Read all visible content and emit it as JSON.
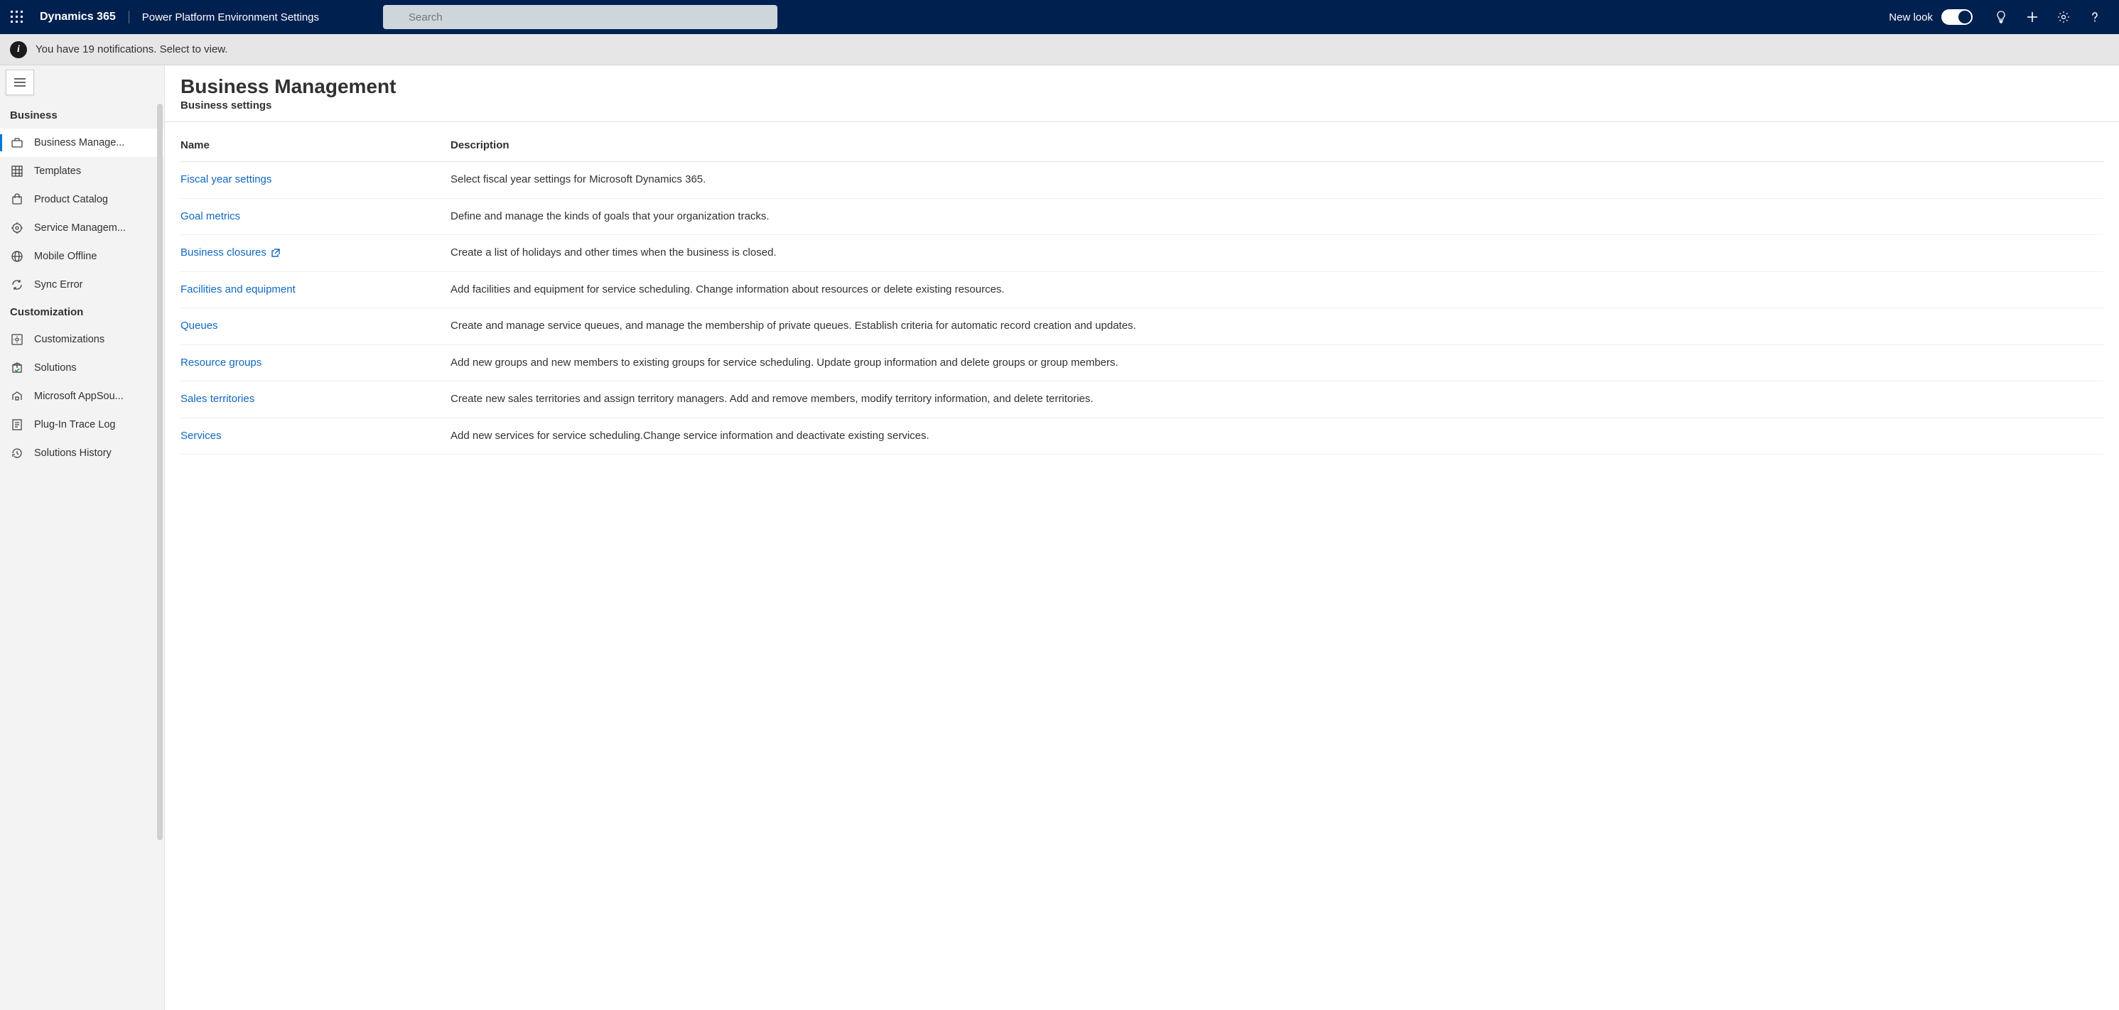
{
  "header": {
    "product": "Dynamics 365",
    "breadcrumb": "Power Platform Environment Settings",
    "search_placeholder": "Search",
    "new_look_label": "New look"
  },
  "notification": {
    "text": "You have 19 notifications. Select to view."
  },
  "sidebar": {
    "sections": [
      {
        "title": "Business",
        "items": [
          {
            "label": "Business Manage...",
            "active": true,
            "icon": "briefcase"
          },
          {
            "label": "Templates",
            "icon": "grid"
          },
          {
            "label": "Product Catalog",
            "icon": "cart"
          },
          {
            "label": "Service Managem...",
            "icon": "service"
          },
          {
            "label": "Mobile Offline",
            "icon": "globe"
          },
          {
            "label": "Sync Error",
            "icon": "sync-error"
          }
        ]
      },
      {
        "title": "Customization",
        "items": [
          {
            "label": "Customizations",
            "icon": "gear-box"
          },
          {
            "label": "Solutions",
            "icon": "package"
          },
          {
            "label": "Microsoft AppSou...",
            "icon": "store"
          },
          {
            "label": "Plug-In Trace Log",
            "icon": "log"
          },
          {
            "label": "Solutions History",
            "icon": "history"
          }
        ]
      }
    ]
  },
  "page": {
    "title": "Business Management",
    "subtitle": "Business settings",
    "columns": {
      "name": "Name",
      "description": "Description"
    },
    "rows": [
      {
        "name": "Fiscal year settings",
        "external": false,
        "description": "Select fiscal year settings for Microsoft Dynamics 365."
      },
      {
        "name": "Goal metrics",
        "external": false,
        "description": "Define and manage the kinds of goals that your organization tracks."
      },
      {
        "name": "Business closures",
        "external": true,
        "description": "Create a list of holidays and other times when the business is closed."
      },
      {
        "name": "Facilities and equipment",
        "external": false,
        "description": "Add facilities and equipment for service scheduling. Change information about resources or delete existing resources."
      },
      {
        "name": "Queues",
        "external": false,
        "description": "Create and manage service queues, and manage the membership of private queues. Establish criteria for automatic record creation and updates."
      },
      {
        "name": "Resource groups",
        "external": false,
        "description": "Add new groups and new members to existing groups for service scheduling. Update group information and delete groups or group members."
      },
      {
        "name": "Sales territories",
        "external": false,
        "description": "Create new sales territories and assign territory managers. Add and remove members, modify territory information, and delete territories."
      },
      {
        "name": "Services",
        "external": false,
        "description": "Add new services for service scheduling.Change service information and deactivate existing services."
      }
    ]
  }
}
